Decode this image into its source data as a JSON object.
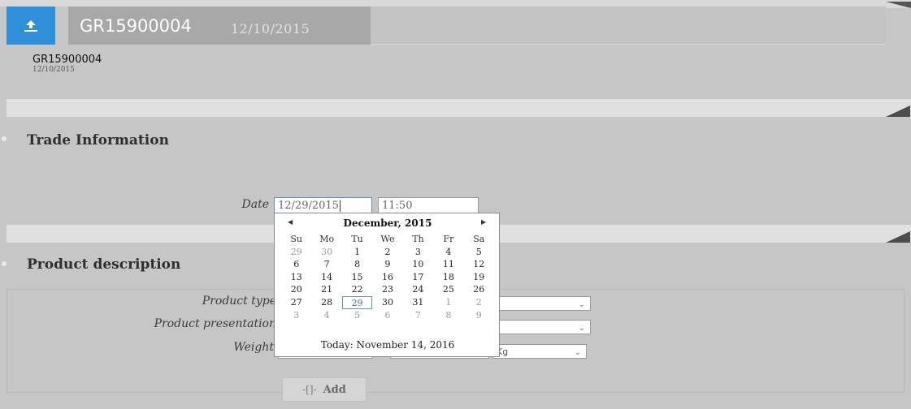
{
  "header": {
    "title": "GR15900004",
    "date": "12/10/2015",
    "upload_icon": "upload-icon"
  },
  "doc_info": {
    "name": "GR15900004",
    "date": "12/10/2015"
  },
  "trade": {
    "title": "Trade Information",
    "date_label": "Date",
    "date_value": "12/29/2015",
    "time_value": "11:50"
  },
  "product": {
    "title": "Product description",
    "type_label": "Product type",
    "presentation_label": "Product presentation",
    "weight_label": "Weight",
    "unit": "Kg"
  },
  "add_button": {
    "label": "Add",
    "icon": "add-icon"
  },
  "calendar": {
    "prev_icon": "◀",
    "next_icon": "▶",
    "month": "December, 2015",
    "weekdays": [
      "Su",
      "Mo",
      "Tu",
      "We",
      "Th",
      "Fr",
      "Sa"
    ],
    "days": [
      {
        "d": "29",
        "t": "other"
      },
      {
        "d": "30",
        "t": "other"
      },
      {
        "d": "1",
        "t": ""
      },
      {
        "d": "2",
        "t": ""
      },
      {
        "d": "3",
        "t": ""
      },
      {
        "d": "4",
        "t": ""
      },
      {
        "d": "5",
        "t": ""
      },
      {
        "d": "6",
        "t": ""
      },
      {
        "d": "7",
        "t": ""
      },
      {
        "d": "8",
        "t": ""
      },
      {
        "d": "9",
        "t": ""
      },
      {
        "d": "10",
        "t": ""
      },
      {
        "d": "11",
        "t": ""
      },
      {
        "d": "12",
        "t": ""
      },
      {
        "d": "13",
        "t": ""
      },
      {
        "d": "14",
        "t": ""
      },
      {
        "d": "15",
        "t": ""
      },
      {
        "d": "16",
        "t": ""
      },
      {
        "d": "17",
        "t": ""
      },
      {
        "d": "18",
        "t": ""
      },
      {
        "d": "19",
        "t": ""
      },
      {
        "d": "20",
        "t": ""
      },
      {
        "d": "21",
        "t": ""
      },
      {
        "d": "22",
        "t": ""
      },
      {
        "d": "23",
        "t": ""
      },
      {
        "d": "24",
        "t": ""
      },
      {
        "d": "25",
        "t": ""
      },
      {
        "d": "26",
        "t": ""
      },
      {
        "d": "27",
        "t": ""
      },
      {
        "d": "28",
        "t": ""
      },
      {
        "d": "29",
        "t": "sel"
      },
      {
        "d": "30",
        "t": ""
      },
      {
        "d": "31",
        "t": ""
      },
      {
        "d": "1",
        "t": "other"
      },
      {
        "d": "2",
        "t": "other"
      },
      {
        "d": "3",
        "t": "other"
      },
      {
        "d": "4",
        "t": "other"
      },
      {
        "d": "5",
        "t": "other"
      },
      {
        "d": "6",
        "t": "other"
      },
      {
        "d": "7",
        "t": "other"
      },
      {
        "d": "8",
        "t": "other"
      },
      {
        "d": "9",
        "t": "other"
      }
    ],
    "today": "Today: November 14, 2016"
  },
  "colors": {
    "accent": "#2f8fd8",
    "background": "#c6c6c6",
    "selected_day": "#5a8fd0"
  }
}
